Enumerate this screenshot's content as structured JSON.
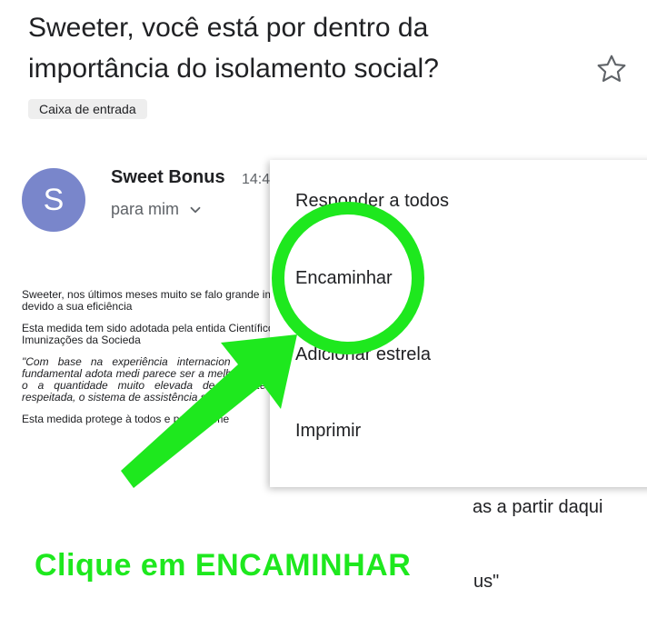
{
  "email": {
    "subject": "Sweeter, você está por dentro da importância do isolamento social?",
    "label": "Caixa de entrada",
    "sender": {
      "initial": "S",
      "name": "Sweet Bonus",
      "time": "14:4",
      "recipient": "para mim",
      "avatar_color": "#7986cb"
    },
    "body": {
      "p1": "Sweeter, nos últimos meses muito se falo grande importância devido a sua eficiência",
      "p2": "Esta medida tem sido adotada pela entida Científico de Imunizações da Socieda",
      "quote": "\"Com base na experiência internacion percebe que é fundamental adota medi parece ser a melhor forma de conter o a quantidade muito elevada de pacientes nas for respeitada, o sistema de assistência se subir.\"",
      "p3": "Esta medida protege à todos e principalme",
      "fragment_right_1": "as a partir daqui",
      "fragment_right_2": "us\""
    }
  },
  "menu": {
    "items": [
      "Responder a todos",
      "Encaminhar",
      "Adicionar estrela",
      "Imprimir"
    ]
  },
  "annotation": {
    "caption": "Clique em ENCAMINHAR",
    "color": "#1ee81e"
  },
  "icons": {
    "star": "star-outline-icon",
    "chevron": "chevron-down-icon"
  }
}
